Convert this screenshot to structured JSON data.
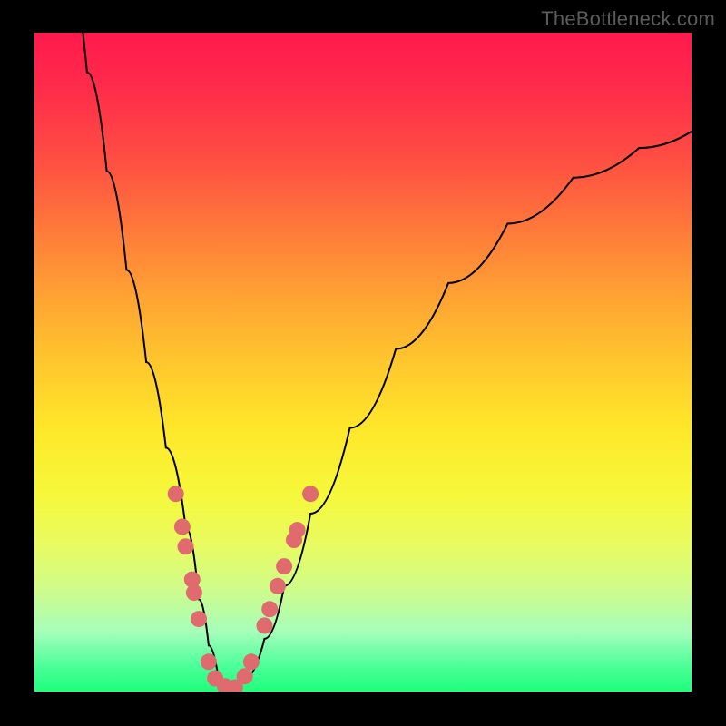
{
  "watermark": "TheBottleneck.com",
  "background": {
    "gradient_stops": [
      {
        "pos": 0.0,
        "color": "#ff1a4d"
      },
      {
        "pos": 0.08,
        "color": "#ff2a4a"
      },
      {
        "pos": 0.2,
        "color": "#ff5142"
      },
      {
        "pos": 0.3,
        "color": "#ff7a3a"
      },
      {
        "pos": 0.4,
        "color": "#ffa233"
      },
      {
        "pos": 0.5,
        "color": "#ffc72d"
      },
      {
        "pos": 0.6,
        "color": "#ffe72a"
      },
      {
        "pos": 0.7,
        "color": "#f6f83a"
      },
      {
        "pos": 0.78,
        "color": "#e8fb62"
      },
      {
        "pos": 0.85,
        "color": "#cdfc8e"
      },
      {
        "pos": 0.91,
        "color": "#a4feba"
      },
      {
        "pos": 0.96,
        "color": "#4eff9a"
      },
      {
        "pos": 1.0,
        "color": "#1eff7c"
      }
    ],
    "frame_color": "#000000",
    "marker_color": "#df6b6f",
    "curve_color": "#000000"
  },
  "chart_data": {
    "type": "line",
    "title": "",
    "xlabel": "",
    "ylabel": "",
    "xlim": [
      0,
      100
    ],
    "ylim": [
      0,
      100
    ],
    "grid": false,
    "series": [
      {
        "name": "bottleneck-curve",
        "x": [
          5,
          8,
          11,
          14,
          17,
          20,
          23,
          25,
          26.5,
          28,
          30,
          32,
          35,
          38,
          42,
          48,
          55,
          63,
          72,
          82,
          92,
          100
        ],
        "y": [
          110,
          94,
          79,
          64,
          50,
          37,
          25,
          14,
          7,
          2,
          0.5,
          2,
          8,
          16,
          27,
          40,
          52,
          62,
          71,
          78,
          82.5,
          85
        ]
      }
    ],
    "markers": {
      "series": "bottleneck-curve",
      "points": [
        {
          "x": 21.5,
          "y": 30
        },
        {
          "x": 22.5,
          "y": 25
        },
        {
          "x": 23.0,
          "y": 22
        },
        {
          "x": 24.0,
          "y": 17
        },
        {
          "x": 24.3,
          "y": 15
        },
        {
          "x": 25.0,
          "y": 11
        },
        {
          "x": 26.5,
          "y": 4.5
        },
        {
          "x": 27.5,
          "y": 2
        },
        {
          "x": 29.0,
          "y": 0.8
        },
        {
          "x": 30.5,
          "y": 0.6
        },
        {
          "x": 32.0,
          "y": 2.3
        },
        {
          "x": 33.0,
          "y": 4.5
        },
        {
          "x": 35.0,
          "y": 10
        },
        {
          "x": 35.8,
          "y": 12.5
        },
        {
          "x": 37.0,
          "y": 16
        },
        {
          "x": 38.0,
          "y": 19
        },
        {
          "x": 39.5,
          "y": 23
        },
        {
          "x": 40.0,
          "y": 24.5
        },
        {
          "x": 42.0,
          "y": 30
        }
      ]
    }
  }
}
